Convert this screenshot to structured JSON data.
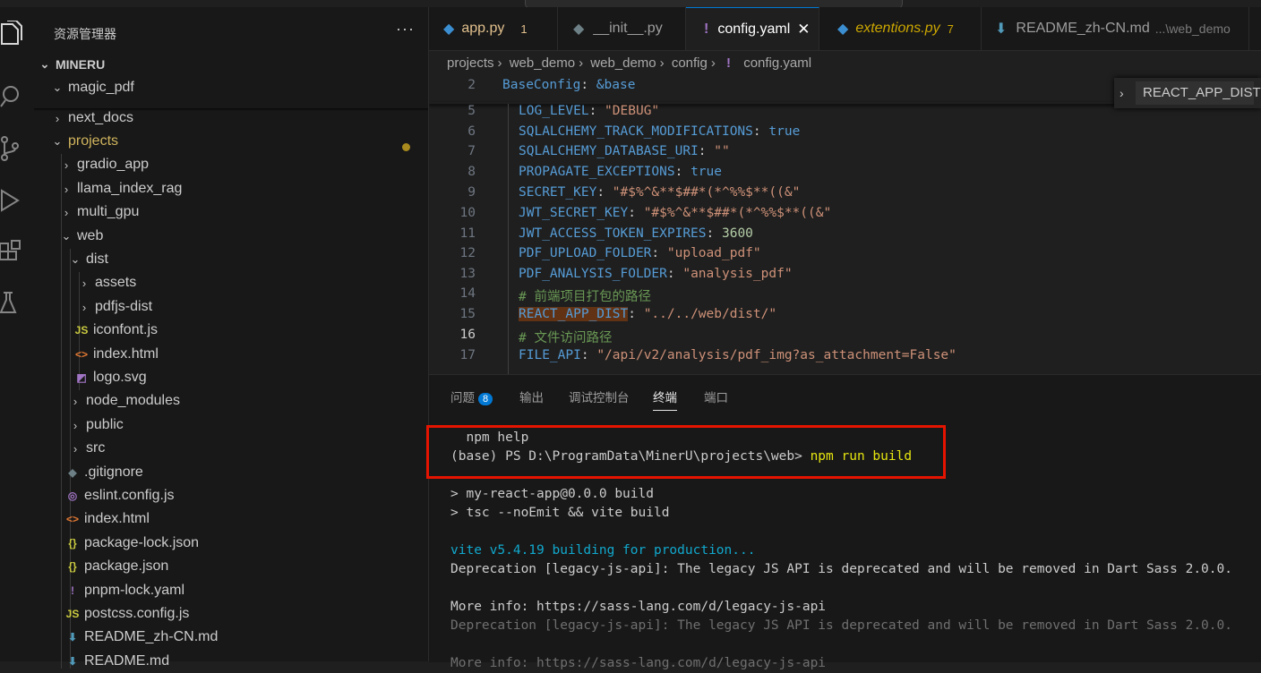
{
  "window": {
    "title": "MinerU"
  },
  "activity_bar": [
    "explorer-icon",
    "search-icon",
    "source-control-icon",
    "run-debug-icon",
    "extensions-icon",
    "testing-icon"
  ],
  "sidebar": {
    "title": "资源管理器",
    "more": "···",
    "root": "MINERU",
    "items": [
      {
        "label": "magic_pdf",
        "type": "folder-open"
      },
      {
        "label": "next_docs",
        "type": "folder"
      },
      {
        "label": "projects",
        "type": "folder-open"
      },
      {
        "label": "gradio_app",
        "type": "folder"
      },
      {
        "label": "llama_index_rag",
        "type": "folder"
      },
      {
        "label": "multi_gpu",
        "type": "folder"
      },
      {
        "label": "web",
        "type": "folder-open"
      },
      {
        "label": "dist",
        "type": "folder-open"
      },
      {
        "label": "assets",
        "type": "folder"
      },
      {
        "label": "pdfjs-dist",
        "type": "folder"
      },
      {
        "label": "iconfont.js",
        "type": "js"
      },
      {
        "label": "index.html",
        "type": "html"
      },
      {
        "label": "logo.svg",
        "type": "svg"
      },
      {
        "label": "node_modules",
        "type": "folder"
      },
      {
        "label": "public",
        "type": "folder"
      },
      {
        "label": "src",
        "type": "folder"
      },
      {
        "label": ".gitignore",
        "type": "git"
      },
      {
        "label": "eslint.config.js",
        "type": "eslint"
      },
      {
        "label": "index.html",
        "type": "html"
      },
      {
        "label": "package-lock.json",
        "type": "json"
      },
      {
        "label": "package.json",
        "type": "json"
      },
      {
        "label": "pnpm-lock.yaml",
        "type": "yaml"
      },
      {
        "label": "postcss.config.js",
        "type": "js"
      },
      {
        "label": "README_zh-CN.md",
        "type": "md"
      },
      {
        "label": "README.md",
        "type": "md"
      }
    ]
  },
  "tabs": [
    {
      "label": "app.py",
      "badge": "1"
    },
    {
      "label": "__init__.py",
      "badge": ""
    },
    {
      "label": "config.yaml",
      "close": "✕"
    },
    {
      "label": "extentions.py",
      "badge": "7"
    },
    {
      "label": "README_zh-CN.md",
      "hint": "...\\web_demo"
    }
  ],
  "breadcrumb": [
    "projects",
    "web_demo",
    "web_demo",
    "config",
    "config.yaml"
  ],
  "find_widget": {
    "value": "REACT_APP_DIST"
  },
  "editor": {
    "sticky": {
      "ln": "2",
      "key": "BaseConfig",
      "anchor": "&base"
    },
    "lines": [
      {
        "ln": "5",
        "key": "LOG_LEVEL",
        "val": "\"DEBUG\""
      },
      {
        "ln": "6",
        "key": "SQLALCHEMY_TRACK_MODIFICATIONS",
        "val": "true"
      },
      {
        "ln": "7",
        "key": "SQLALCHEMY_DATABASE_URI",
        "val": "\"\""
      },
      {
        "ln": "8",
        "key": "PROPAGATE_EXCEPTIONS",
        "val": "true"
      },
      {
        "ln": "9",
        "key": "SECRET_KEY",
        "val": "\"#$%^&**$##*(*^%%$**((&\""
      },
      {
        "ln": "10",
        "key": "JWT_SECRET_KEY",
        "val": "\"#$%^&**$##*(*^%%$**((&\""
      },
      {
        "ln": "11",
        "key": "JWT_ACCESS_TOKEN_EXPIRES",
        "val": "3600"
      },
      {
        "ln": "12",
        "key": "PDF_UPLOAD_FOLDER",
        "val": "\"upload_pdf\""
      },
      {
        "ln": "13",
        "key": "PDF_ANALYSIS_FOLDER",
        "val": "\"analysis_pdf\""
      },
      {
        "ln": "14",
        "comment": "# 前端项目打包的路径"
      },
      {
        "ln": "15",
        "key": "REACT_APP_DIST",
        "val": "\"../../web/dist/\""
      },
      {
        "ln": "16",
        "comment": "# 文件访问路径"
      },
      {
        "ln": "17",
        "key": "FILE_API",
        "val": "\"/api/v2/analysis/pdf_img?as_attachment=False\""
      }
    ]
  },
  "panel": {
    "tabs": [
      "问题",
      "输出",
      "调试控制台",
      "终端",
      "端口"
    ],
    "problems_count": "8",
    "terminal": [
      "  npm help",
      "(base) PS D:\\ProgramData\\MinerU\\projects\\web> ",
      "npm run build",
      "> my-react-app@0.0.0 build",
      "> tsc --noEmit && vite build",
      "vite v5.4.19 building for production...",
      "Deprecation [legacy-js-api]: The legacy JS API is deprecated and will be removed in Dart Sass 2.0.0.",
      "More info: https://sass-lang.com/d/legacy-js-api",
      "Deprecation [legacy-js-api]: The legacy JS API is deprecated and will be removed in Dart Sass 2.0.0.",
      "More info: https://sass-lang.com/d/legacy-js-api"
    ]
  },
  "colors": {
    "accent": "#0078d4",
    "highlight_box": "#e51400",
    "modified_dot": "#a88a1e"
  }
}
